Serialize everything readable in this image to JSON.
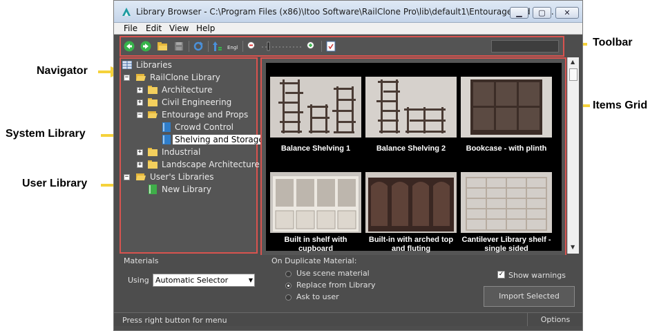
{
  "callouts": {
    "toolbar": "Toolbar",
    "navigator": "Navigator",
    "items_grid": "Items Grid",
    "system_library": "System Library",
    "user_library": "User Library"
  },
  "window": {
    "title": "Library Browser - C:\\Program Files (x86)\\Itoo Software\\RailClone Pro\\lib\\default1\\Entourage and Pro..."
  },
  "menu": [
    "File",
    "Edit",
    "View",
    "Help"
  ],
  "toolbar": {
    "lang_label": "Engl"
  },
  "tree": {
    "root": "Libraries",
    "railclone_library": "RailClone Library",
    "architecture": "Architecture",
    "civil_engineering": "Civil Engineering",
    "entourage_and_props": "Entourage and Props",
    "crowd_control": "Crowd Control",
    "shelving_and_storage": "Shelving and Storage",
    "industrial": "Industrial",
    "landscape_architecture": "Landscape Architecture",
    "users_libraries": "User's Libraries",
    "new_library": "New Library"
  },
  "items": [
    {
      "label": "Balance Shelving 1"
    },
    {
      "label": "Balance Shelving 2"
    },
    {
      "label": "Bookcase - with plinth"
    },
    {
      "label": "Built in shelf with cupboard"
    },
    {
      "label": "Built-in with arched top and fluting"
    },
    {
      "label": "Cantilever Library shelf - single sided"
    }
  ],
  "materials": {
    "title": "Materials",
    "using_label": "Using",
    "selector_value": "Automatic Selector"
  },
  "duplicate": {
    "title": "On Duplicate Material:",
    "options": [
      "Use scene material",
      "Replace from Library",
      "Ask to user"
    ],
    "selected": "Replace from Library"
  },
  "show_warnings": {
    "label": "Show warnings",
    "checked": true
  },
  "import_button": "Import Selected",
  "status": {
    "text": "Press right button for menu",
    "options": "Options"
  },
  "colors": {
    "highlight_border": "#d9534f",
    "callout_arrow": "#f5d23b",
    "panel_bg": "#555555"
  }
}
